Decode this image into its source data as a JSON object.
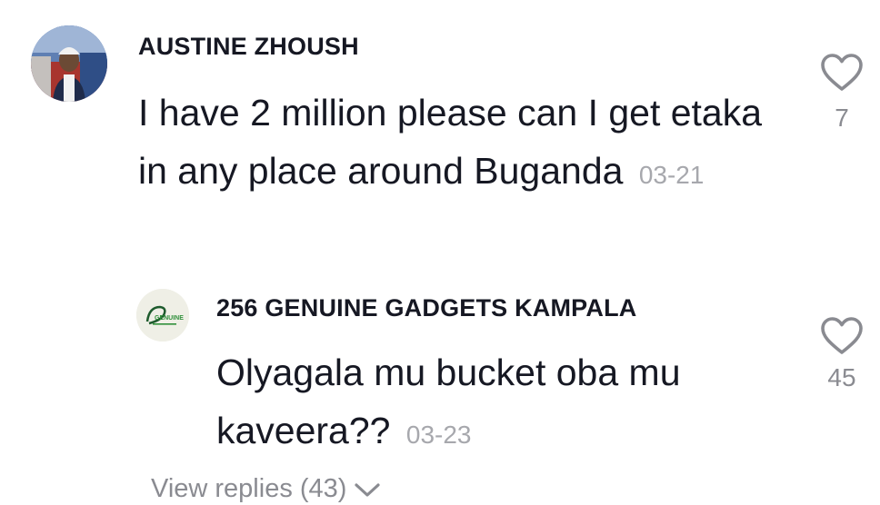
{
  "comments": [
    {
      "username": "AUSTINE ZHOUSH",
      "text": "I have 2 million please can I get etaka in any place around Buganda",
      "date": "03-21",
      "likes": "7"
    }
  ],
  "reply": {
    "username": "256 GENUINE GADGETS KAMPALA",
    "text": "Olyagala mu bucket oba mu kaveera??",
    "date": "03-23",
    "likes": "45",
    "avatar_logo_text": "GENUINE"
  },
  "view_replies": {
    "label": "View replies (43)"
  },
  "colors": {
    "text": "#161823",
    "muted": "#8a8b91",
    "timestamp": "#a7a8ad",
    "heart_stroke": "#8a8b91"
  },
  "icons": {
    "like": "heart-outline-icon",
    "expand": "chevron-down-icon"
  }
}
